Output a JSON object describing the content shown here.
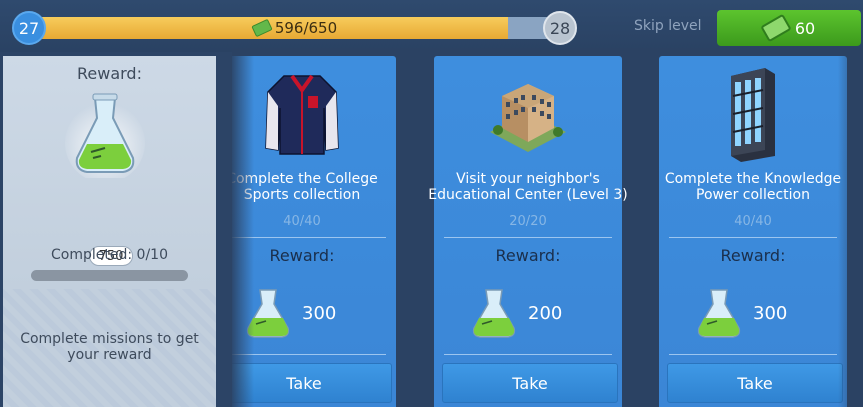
{
  "level": {
    "current": "27",
    "next": "28"
  },
  "xp": {
    "text": "596/650",
    "fraction": 0.917
  },
  "skip": {
    "label": "Skip level",
    "cost": "60"
  },
  "collection_reward": {
    "title": "Reward:",
    "amount": "750",
    "completed": "Completed: 0/10",
    "completed_fraction": 0,
    "hint": "Complete missions to get your reward"
  },
  "missions": [
    {
      "title_line1": "Complete the College",
      "title_line2": "Sports collection",
      "progress": "40/40",
      "reward_label": "Reward:",
      "reward": "300",
      "button": "Take",
      "icon": "varsity-jacket-icon"
    },
    {
      "title_line1": "Visit your neighbor's",
      "title_line2": "Educational Center (Level 3)",
      "progress": "20/20",
      "reward_label": "Reward:",
      "reward": "200",
      "button": "Take",
      "icon": "building-icon"
    },
    {
      "title_line1": "Complete the Knowledge",
      "title_line2": "Power collection",
      "progress": "40/40",
      "reward_label": "Reward:",
      "reward": "300",
      "button": "Take",
      "icon": "server-rack-icon"
    }
  ],
  "colors": {
    "accent_blue": "#3e8ede",
    "skip_green": "#4cb025",
    "xp_gold": "#f0bb48"
  }
}
